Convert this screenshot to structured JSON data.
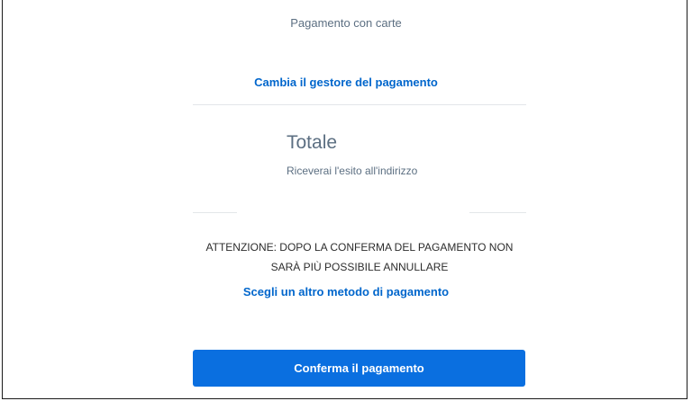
{
  "header": {
    "title": "Pagamento con carte"
  },
  "links": {
    "change_manager": "Cambia il gestore del pagamento",
    "choose_method": "Scegli un altro metodo di pagamento"
  },
  "summary": {
    "total_label": "Totale",
    "result_info": "Riceverai l'esito all'indirizzo"
  },
  "warning": {
    "line1": "ATTENZIONE: DOPO LA CONFERMA DEL PAGAMENTO NON",
    "line2": "SARÀ PIÙ POSSIBILE ANNULLARE"
  },
  "actions": {
    "confirm_label": "Conferma il pagamento"
  },
  "colors": {
    "accent": "#0a6fe0",
    "link": "#0066cc",
    "muted_text": "#5c6f82"
  }
}
